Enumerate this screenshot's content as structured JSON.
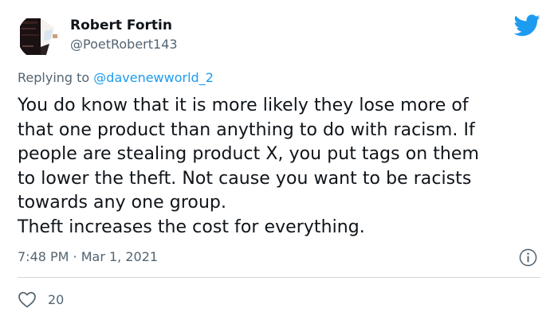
{
  "author": {
    "display_name": "Robert Fortin",
    "handle": "@PoetRobert143"
  },
  "reply": {
    "prefix": "Replying to ",
    "to_handle": "@davenewworld_2"
  },
  "body": {
    "lines": [
      "You do know that it is more likely they lose more of",
      "that one product than anything to do with racism. If",
      "people are stealing product X, you put tags on them",
      "to lower the theft. Not cause you want to be racists",
      "towards any one group.",
      "Theft increases the cost for everything."
    ]
  },
  "meta": {
    "timestamp": "7:48 PM · Mar 1, 2021"
  },
  "actions": {
    "like_count": "20"
  },
  "icons": {
    "brand": "twitter-bird-icon",
    "info": "info-icon",
    "like": "heart-icon"
  },
  "colors": {
    "brand_blue": "#1d9bf0",
    "secondary_text": "#536471",
    "primary_text": "#0f1419",
    "divider": "#cfd9de"
  }
}
